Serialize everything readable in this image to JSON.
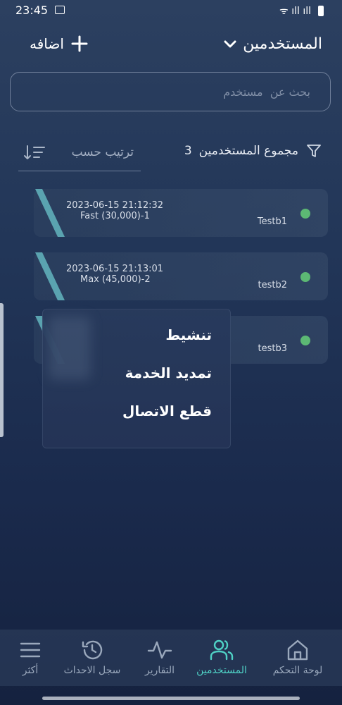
{
  "status_bar": {
    "time": "23:45",
    "signal_text": "ᯤ ıll ıll"
  },
  "header": {
    "title": "المستخدمين",
    "add_label": "اضافه"
  },
  "search": {
    "placeholder": "بحث عن  مستخدم"
  },
  "toolbar": {
    "total_label": "مجموع المستخدمين",
    "total_count": "3",
    "sort_label": "ترتيب حسب"
  },
  "users": [
    {
      "timestamp": "2023-06-15 21:12:32",
      "plan": "Fast (30,000)-1",
      "name": "Testb1",
      "status_color": "#5cb874"
    },
    {
      "timestamp": "2023-06-15 21:13:01",
      "plan": "Max (45,000)-2",
      "name": "testb2",
      "status_color": "#5cb874"
    },
    {
      "timestamp": "",
      "plan": "",
      "name": "testb3",
      "status_color": "#5cb874"
    }
  ],
  "popup_menu": {
    "items": [
      "تنشيط",
      "تمديد الخدمة",
      "قطع الاتصال"
    ]
  },
  "bottom_nav": {
    "items": [
      {
        "label": "لوحة التحكم",
        "icon": "home-icon",
        "active": false
      },
      {
        "label": "المستخدمين",
        "icon": "users-icon",
        "active": true
      },
      {
        "label": "التقارير",
        "icon": "activity-icon",
        "active": false
      },
      {
        "label": "سجل الاحداث",
        "icon": "history-icon",
        "active": false
      },
      {
        "label": "أكثر",
        "icon": "menu-icon",
        "active": false
      }
    ]
  },
  "colors": {
    "accent": "#4fd1c5",
    "online": "#5cb874",
    "stripe": "#5aa3b0"
  }
}
